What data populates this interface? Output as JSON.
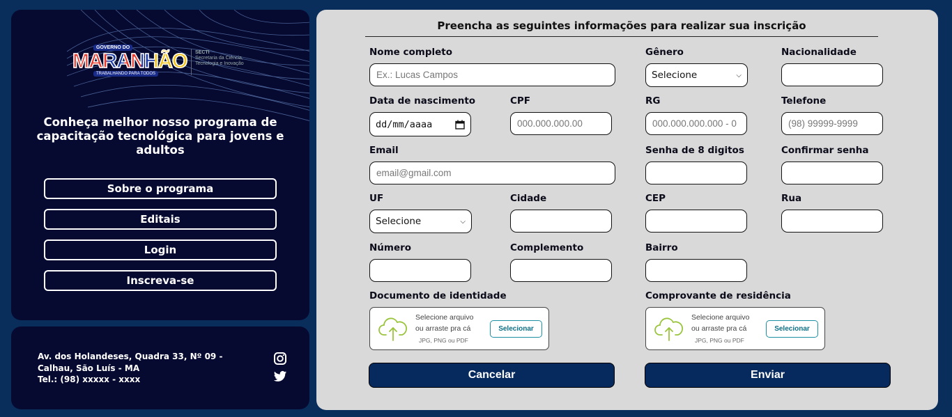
{
  "sidebar": {
    "logo": {
      "gov": "GOVERNO DO",
      "name": "MARANHÃO",
      "tagline": "TRABALHANDO PARA TODOS",
      "secretariat_abbr": "SECTI",
      "secretariat_name": "Secretaria da Ciência, Tecnologia e Inovação"
    },
    "headline": "Conheça melhor nosso programa de capacitação tecnológica para jovens e adultos",
    "menu": [
      {
        "label": "Sobre o programa"
      },
      {
        "label": "Editais"
      },
      {
        "label": "Login"
      },
      {
        "label": "Inscreva-se"
      }
    ]
  },
  "footer": {
    "address_line1": "Av. dos Holandeses, Quadra 33, Nº 09 - Calhau, São Luís - MA",
    "phone": "Tel.: (98) xxxxx - xxxx",
    "icons": [
      "instagram-icon",
      "twitter-icon"
    ]
  },
  "form": {
    "title": "Preencha as seguintes informações para realizar sua inscrição",
    "fields": {
      "nome": {
        "label": "Nome completo",
        "placeholder": "Ex.: Lucas Campos"
      },
      "genero": {
        "label": "Gênero",
        "value": "Selecione"
      },
      "nacionalidade": {
        "label": "Nacionalidade",
        "placeholder": ""
      },
      "nascimento": {
        "label": "Data de nascimento",
        "value": "dd/mm/aaaa"
      },
      "cpf": {
        "label": "CPF",
        "placeholder": "000.000.000.00"
      },
      "rg": {
        "label": "RG",
        "placeholder": "000.000.000.000 - 0"
      },
      "telefone": {
        "label": "Telefone",
        "placeholder": "(98) 99999-9999"
      },
      "email": {
        "label": "Email",
        "placeholder": "email@gmail.com"
      },
      "senha": {
        "label": "Senha de 8 digitos",
        "placeholder": ""
      },
      "confirmar": {
        "label": "Confirmar senha",
        "placeholder": ""
      },
      "uf": {
        "label": "UF",
        "value": "Selecione"
      },
      "cidade": {
        "label": "Cidade",
        "placeholder": ""
      },
      "cep": {
        "label": "CEP",
        "placeholder": ""
      },
      "rua": {
        "label": "Rua",
        "placeholder": ""
      },
      "numero": {
        "label": "Número",
        "placeholder": ""
      },
      "complemento": {
        "label": "Complemento",
        "placeholder": ""
      },
      "bairro": {
        "label": "Bairro",
        "placeholder": ""
      }
    },
    "uploads": {
      "identidade": {
        "label": "Documento de identidade"
      },
      "residencia": {
        "label": "Comprovante de residência"
      },
      "prompt_line1": "Selecione arquivo",
      "prompt_line2": "ou arraste pra cá",
      "formats": "JPG, PNG ou PDF",
      "button": "Selecionar"
    },
    "actions": {
      "cancel": "Cancelar",
      "submit": "Enviar"
    }
  },
  "colors": {
    "page_bg": "#0a2e5c",
    "panel_dark": "#070a30",
    "form_bg": "#d9d9d9",
    "button_blue": "#062a5e",
    "upload_accent": "#1d8fa3",
    "cloud_icon": "#9ac43c"
  }
}
